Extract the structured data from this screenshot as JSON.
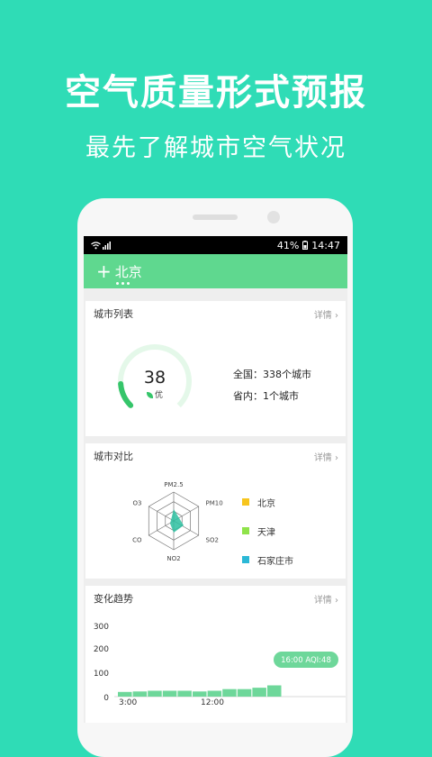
{
  "promo": {
    "headline": "空气质量形式预报",
    "subline": "最先了解城市空气状况"
  },
  "status_bar": {
    "battery": "41%",
    "time": "14:47"
  },
  "app_bar": {
    "plus": "+",
    "city": "北京"
  },
  "city_list": {
    "title": "城市列表",
    "more": "详情 ›",
    "aqi": "38",
    "grade": "优",
    "aqi_fraction": 0.15,
    "national": "全国：338个城市",
    "province": "省内：1个城市"
  },
  "compare": {
    "title": "城市对比",
    "more": "详情 ›",
    "axes": [
      "PM2.5",
      "PM10",
      "SO2",
      "NO2",
      "CO",
      "O3"
    ],
    "cities": [
      {
        "name": "北京",
        "color": "#f7c51e"
      },
      {
        "name": "天津",
        "color": "#8fe34a"
      },
      {
        "name": "石家庄市",
        "color": "#2bb8d6"
      }
    ]
  },
  "trend": {
    "title": "变化趋势",
    "more": "详情 ›",
    "tooltip": "16:00 AQI:48",
    "y_ticks": [
      "300",
      "200",
      "100",
      "0"
    ],
    "x_ticks": [
      "3:00",
      "12:00"
    ]
  },
  "chart_data": {
    "type": "bar",
    "title": "变化趋势",
    "ylim": [
      0,
      300
    ],
    "values": [
      20,
      22,
      25,
      25,
      25,
      22,
      25,
      32,
      32,
      38,
      48
    ],
    "ytick_labels": [
      "300",
      "200",
      "100",
      "0"
    ],
    "xtick_labels": [
      "3:00",
      "12:00"
    ]
  },
  "colors": {
    "background": "#2fdcb6",
    "app_bar": "#5fd88f",
    "accent": "#35c56a"
  }
}
